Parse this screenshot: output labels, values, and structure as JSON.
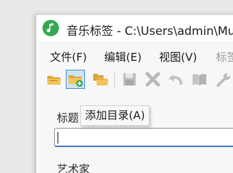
{
  "window": {
    "title": "音乐标签 - C:\\Users\\admin\\Mu"
  },
  "menu": {
    "file": "文件(F)",
    "edit": "编辑(E)",
    "view": "视图(V)",
    "tag": "标签"
  },
  "tooltip": {
    "text": "添加目录(A)"
  },
  "form": {
    "title_label": "标题",
    "title_value": "",
    "artist_label": "艺术家"
  },
  "colors": {
    "app_icon": "#34a853",
    "folder": "#e8b64a",
    "input_focus": "#3470c0"
  },
  "icons": [
    "open-folder-icon",
    "add-folder-icon",
    "copy-folders-icon",
    "save-icon",
    "delete-icon",
    "undo-icon",
    "book-icon",
    "wrench-icon"
  ]
}
